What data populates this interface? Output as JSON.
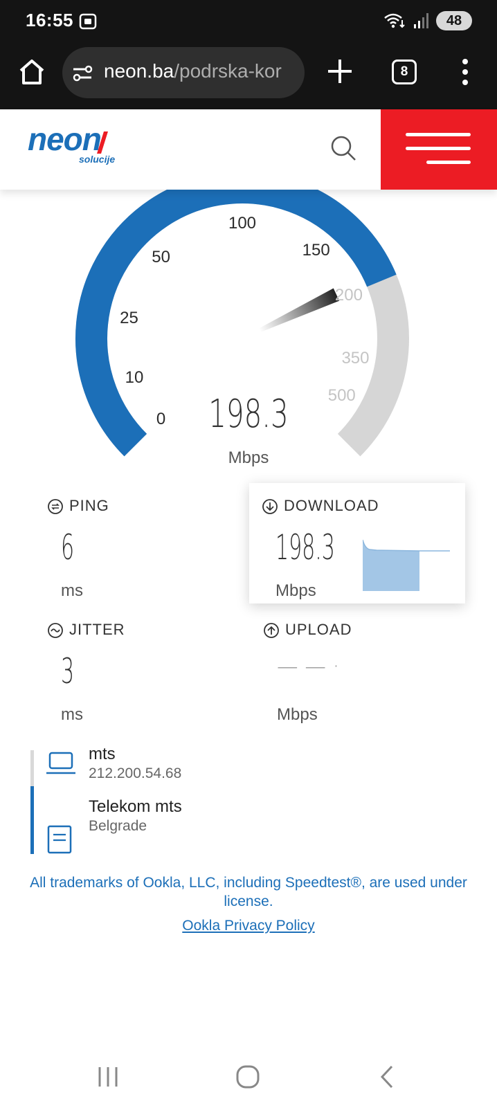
{
  "status_bar": {
    "time": "16:55",
    "battery": "48"
  },
  "browser": {
    "url_host": "neon.ba",
    "url_path": "/podrska-kor",
    "tab_count": "8"
  },
  "site": {
    "logo_text": "neon",
    "logo_subtext": "solucije",
    "accent_color": "#ec1c24",
    "brand_color": "#1c6fb8"
  },
  "gauge": {
    "value": "198.3",
    "unit": "Mbps",
    "tick_labels": [
      "0",
      "10",
      "25",
      "50",
      "100",
      "150",
      "200",
      "350",
      "500"
    ],
    "needle_tick": "200",
    "filled_fraction": 0.75
  },
  "metrics": {
    "ping": {
      "label": "PING",
      "value": "6",
      "unit": "ms"
    },
    "download": {
      "label": "DOWNLOAD",
      "value": "198.3",
      "unit": "Mbps"
    },
    "jitter": {
      "label": "JITTER",
      "value": "3",
      "unit": "ms"
    },
    "upload": {
      "label": "UPLOAD",
      "value": "— — ·",
      "unit": "Mbps"
    }
  },
  "server": {
    "isp_name": "mts",
    "ip": "212.200.54.68",
    "host_name": "Telekom mts",
    "host_city": "Belgrade"
  },
  "footer": {
    "trademark_note": "All trademarks of Ookla, LLC, including Speedtest®, are used under license.",
    "privacy_link": "Ookla Privacy Policy"
  }
}
